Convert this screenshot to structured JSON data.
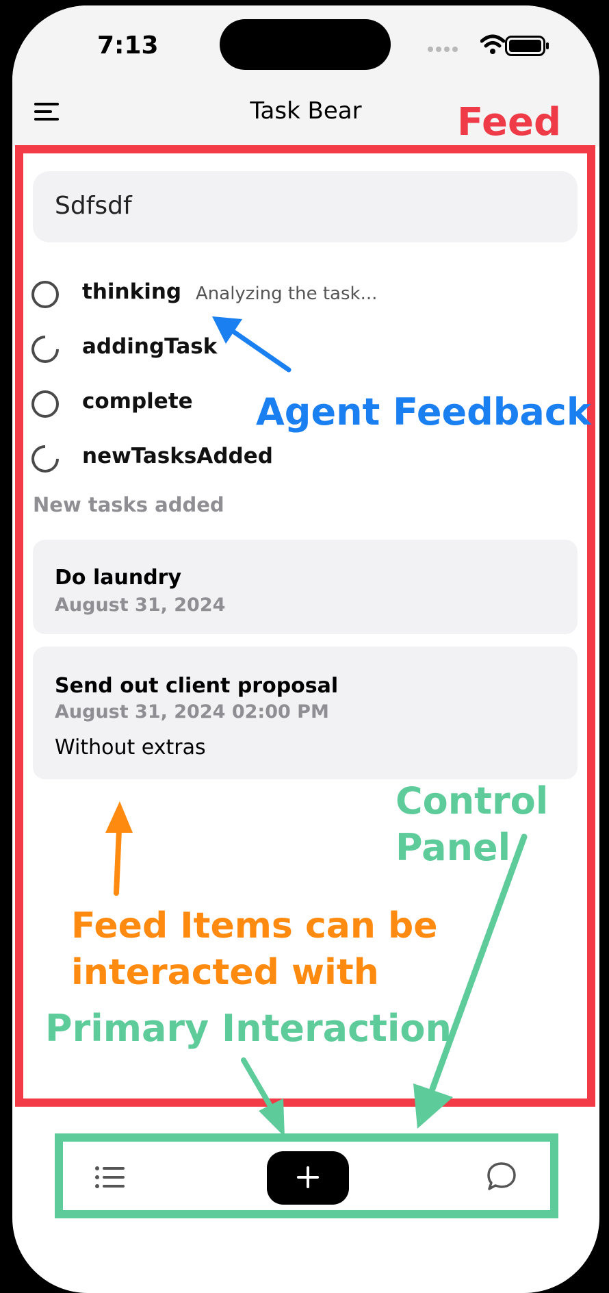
{
  "status": {
    "time": "7:13"
  },
  "header": {
    "title": "Task Bear"
  },
  "feed": {
    "prompt": "Sdfsdf",
    "steps": [
      {
        "label": "thinking",
        "detail": "Analyzing the task..."
      },
      {
        "label": "addingTask",
        "detail": ""
      },
      {
        "label": "complete",
        "detail": ""
      },
      {
        "label": "newTasksAdded",
        "detail": ""
      }
    ],
    "section_label": "New tasks added",
    "tasks": [
      {
        "title": "Do laundry",
        "date": "August 31, 2024",
        "note": ""
      },
      {
        "title": "Send out client proposal",
        "date": "August 31, 2024 02:00 PM",
        "note": "Without extras"
      }
    ]
  },
  "annotations": {
    "feed": "Feed",
    "agent_feedback": "Agent Feedback",
    "feed_items_line1": "Feed Items can be",
    "feed_items_line2": "interacted with",
    "primary_interaction": "Primary Interaction",
    "control_panel_line1": "Control",
    "control_panel_line2": "Panel"
  },
  "colors": {
    "feed_annotation": "#f23b47",
    "agent_annotation": "#1a7ff0",
    "items_annotation": "#ff8a10",
    "control_annotation": "#5ecb9a"
  },
  "icons": {
    "menu": "hamburger-menu-icon",
    "list": "list-icon",
    "add": "plus-icon",
    "chat": "chat-bubble-icon"
  }
}
